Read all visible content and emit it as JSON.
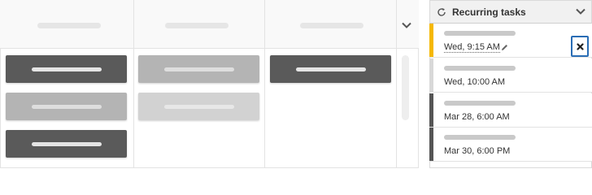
{
  "board": {
    "columns": [
      {
        "cards": [
          "dark",
          "mid",
          "dark"
        ]
      },
      {
        "cards": [
          "mid",
          "light"
        ]
      },
      {
        "cards": [
          "dark"
        ]
      }
    ]
  },
  "panel": {
    "title": "Recurring tasks",
    "tasks": [
      {
        "time": "Wed, 9:15 AM",
        "stripe_color": "#f5b800",
        "editing": true
      },
      {
        "time": "Wed, 10:00 AM",
        "stripe_color": "#d8d8d8",
        "editing": false
      },
      {
        "time": "Mar 28, 6:00 AM",
        "stripe_color": "#555555",
        "editing": false
      },
      {
        "time": "Mar 30, 6:00 PM",
        "stripe_color": "#555555",
        "editing": false
      }
    ]
  },
  "colors": {
    "accent_blue": "#2a6db5",
    "card_dark": "#5a5a5a",
    "card_mid": "#b4b4b4",
    "card_light": "#d2d2d2",
    "stripe_yellow": "#f5b800"
  },
  "icons": {
    "expand": "chevron-down-icon",
    "collapse": "chevron-down-icon",
    "recurring": "refresh-icon",
    "edit": "pencil-icon",
    "close": "close-icon"
  }
}
